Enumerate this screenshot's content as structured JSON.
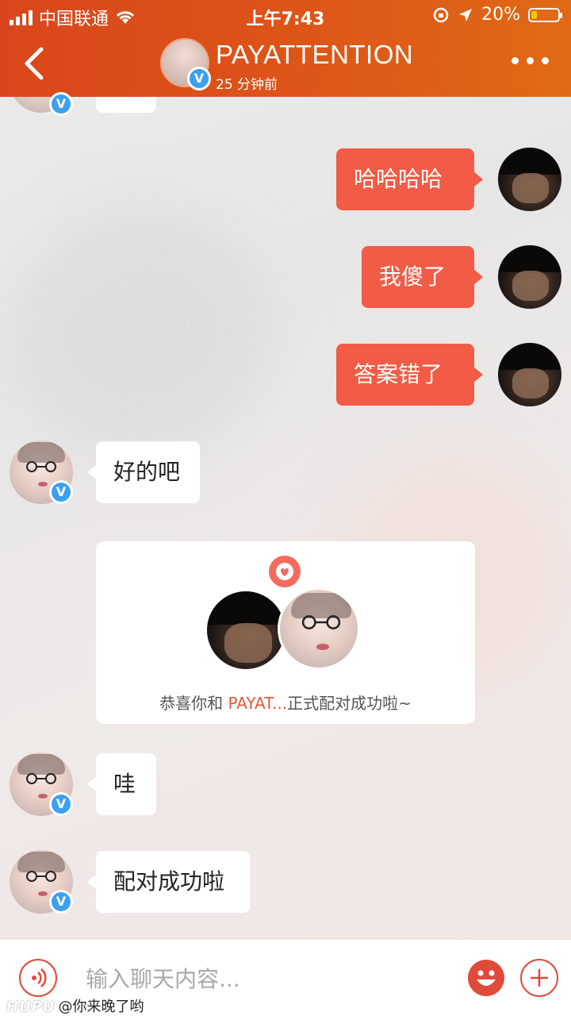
{
  "status_bar": {
    "carrier": "中国联通",
    "time": "上午7:43",
    "battery": "20%",
    "battery_level": 0.2
  },
  "header": {
    "name": "PAYATTENTION",
    "subtitle": "25 分钟前",
    "verified_badge": "V"
  },
  "messages": [
    {
      "side": "me",
      "text": "哈哈哈哈"
    },
    {
      "side": "me",
      "text": "我傻了"
    },
    {
      "side": "me",
      "text": "答案错了"
    },
    {
      "side": "other",
      "text": "好的吧"
    },
    {
      "side": "other",
      "text": "哇"
    },
    {
      "side": "other",
      "text": "配对成功啦"
    }
  ],
  "match_card": {
    "prefix": "恭喜你和 ",
    "name": "PAYAT...",
    "suffix": "正式配对成功啦~"
  },
  "input_bar": {
    "placeholder": "输入聊天内容..."
  },
  "watermark": {
    "brand": "HUPU",
    "user": "@你来晚了哟"
  },
  "colors": {
    "header_start": "#d9461d",
    "header_end": "#e06a16",
    "bubble_me": "#f25b45",
    "accent": "#e04a3a",
    "verified": "#3ba0f0"
  }
}
